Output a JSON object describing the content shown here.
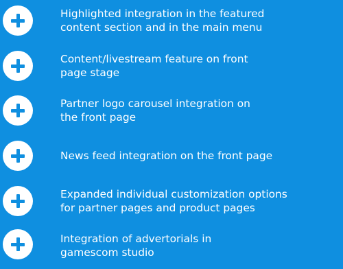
{
  "items": [
    {
      "icon": "plus-circle-icon",
      "lines": [
        "Highlighted integration in the featured",
        "content section and in the main menu"
      ]
    },
    {
      "icon": "plus-circle-icon",
      "lines": [
        "Content/livestream feature on front",
        "page stage"
      ]
    },
    {
      "icon": "plus-circle-icon",
      "lines": [
        "Partner logo carousel integration on",
        "the front page"
      ]
    },
    {
      "icon": "plus-circle-icon",
      "lines": [
        "News feed integration on the front page"
      ]
    },
    {
      "icon": "plus-circle-icon",
      "lines": [
        "Expanded individual customization options",
        "for partner pages and product pages"
      ]
    },
    {
      "icon": "plus-circle-icon",
      "lines": [
        "Integration of advertorials in",
        "gamescom studio"
      ]
    }
  ],
  "colors": {
    "background": "#0f8fe0",
    "icon_circle": "#ffffff",
    "icon_cross": "#0f8fe0",
    "text": "#ffffff"
  }
}
